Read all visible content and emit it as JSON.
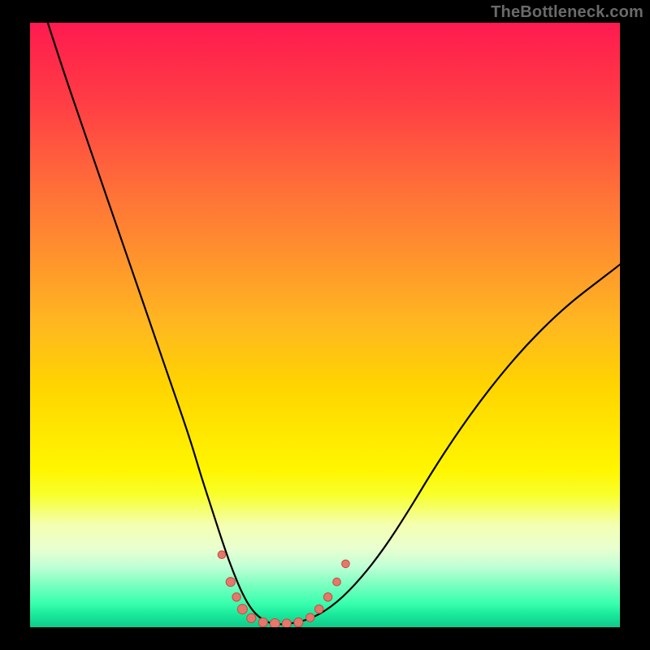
{
  "watermark": "TheBottleneck.com",
  "colors": {
    "background": "#000000",
    "curve": "#000000",
    "marker_fill": "#e6776b",
    "marker_stroke": "#c24d45"
  },
  "chart_data": {
    "type": "line",
    "title": "",
    "xlabel": "",
    "ylabel": "",
    "xlim": [
      0,
      100
    ],
    "ylim": [
      0,
      100
    ],
    "grid": false,
    "legend": false,
    "series": [
      {
        "name": "curve",
        "x": [
          3,
          6,
          9,
          12,
          15,
          18,
          21,
          24,
          27,
          29,
          31,
          33,
          34.5,
          36,
          37.5,
          39,
          41,
          44,
          48,
          52,
          56,
          60,
          64,
          68,
          72,
          76,
          80,
          84,
          88,
          92,
          96,
          100
        ],
        "y": [
          100,
          91,
          82.5,
          74,
          65.5,
          57,
          48.5,
          40,
          31.5,
          25,
          19,
          13,
          9,
          5.5,
          3,
          1.5,
          0.5,
          0.5,
          1.5,
          4,
          8,
          13,
          19,
          25.5,
          31.5,
          37,
          42,
          46.5,
          50.5,
          54,
          57,
          60
        ]
      }
    ],
    "markers": {
      "name": "highlight-points",
      "points": [
        {
          "x": 32.5,
          "y": 12,
          "r": 1.2
        },
        {
          "x": 34.0,
          "y": 7.5,
          "r": 1.4
        },
        {
          "x": 35.0,
          "y": 5.0,
          "r": 1.3
        },
        {
          "x": 36.0,
          "y": 3.0,
          "r": 1.5
        },
        {
          "x": 37.5,
          "y": 1.5,
          "r": 1.4
        },
        {
          "x": 39.5,
          "y": 0.8,
          "r": 1.4
        },
        {
          "x": 41.5,
          "y": 0.6,
          "r": 1.5
        },
        {
          "x": 43.5,
          "y": 0.6,
          "r": 1.4
        },
        {
          "x": 45.5,
          "y": 0.8,
          "r": 1.4
        },
        {
          "x": 47.5,
          "y": 1.6,
          "r": 1.3
        },
        {
          "x": 49.0,
          "y": 3.0,
          "r": 1.3
        },
        {
          "x": 50.5,
          "y": 5.0,
          "r": 1.3
        },
        {
          "x": 52.0,
          "y": 7.5,
          "r": 1.2
        },
        {
          "x": 53.5,
          "y": 10.5,
          "r": 1.2
        }
      ]
    }
  }
}
